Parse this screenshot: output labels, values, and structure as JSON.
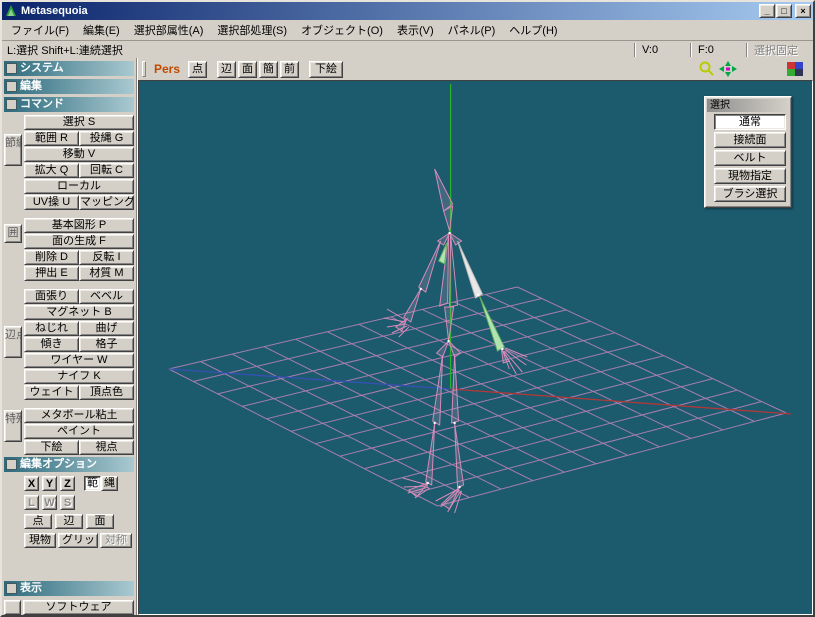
{
  "window": {
    "title": "Metasequoia",
    "controls": {
      "minimize": "_",
      "maximize": "□",
      "close": "×"
    }
  },
  "menu": {
    "items": [
      "ファイル(F)",
      "編集(E)",
      "選択部属性(A)",
      "選択部処理(S)",
      "オブジェクト(O)",
      "表示(V)",
      "パネル(P)",
      "ヘルプ(H)"
    ]
  },
  "statusbar": {
    "hint": "L:選択  Shift+L:連続選択",
    "vertex_count": "V:0",
    "face_count": "F:0",
    "lock_label": "選択固定"
  },
  "toolbar": {
    "view_mode": "Pers",
    "buttons": [
      "点",
      "辺",
      "面",
      "簡",
      "前",
      "下絵"
    ],
    "icons": [
      "zoom-icon",
      "axis-gizmo-icon",
      "palette-icon"
    ]
  },
  "sidebar": {
    "headers": {
      "system": "システム",
      "edit": "編集",
      "command": "コマンド",
      "options": "編集オプション",
      "display": "表示"
    },
    "commands": [
      "選択 S",
      "範囲 R",
      "投縄 G",
      "移動 V",
      "拡大 Q",
      "回転 C",
      "ローカル",
      "UV操 U",
      "マッピング",
      "基本図形 P",
      "面の生成 F",
      "削除 D",
      "反転 I",
      "押出 E",
      "材質 M",
      "面張り",
      "ベベル",
      "マグネット B",
      "ねじれ",
      "曲げ",
      "傾き",
      "格子",
      "ワイヤー W",
      "ナイフ K",
      "ウェイト",
      "頂点色",
      "メタボール粘土",
      "ペイント",
      "下絵",
      "視点"
    ],
    "tabs": [
      "節纏",
      "囲",
      "辺点",
      "特殊"
    ],
    "options": {
      "axis": [
        "X",
        "Y",
        "Z"
      ],
      "range": [
        "範",
        "縄"
      ],
      "lws": [
        "L",
        "W",
        "S"
      ],
      "elements": [
        "点",
        "辺",
        "面"
      ],
      "misc": [
        "現物",
        "グリッド",
        "対称"
      ]
    },
    "display_mode": "ソフトウェア"
  },
  "selection_panel": {
    "title": "選択",
    "buttons": [
      "通常",
      "接続面",
      "ベルト",
      "現物指定",
      "ブラシ選択"
    ],
    "active": "通常"
  },
  "viewport": {
    "colors": {
      "background": "#1c5a6e",
      "grid": "#b583b5",
      "axis_x": "#b03838",
      "axis_y": "#28b428",
      "axis_z": "#3850b4",
      "bones": "#d88bb8"
    }
  }
}
